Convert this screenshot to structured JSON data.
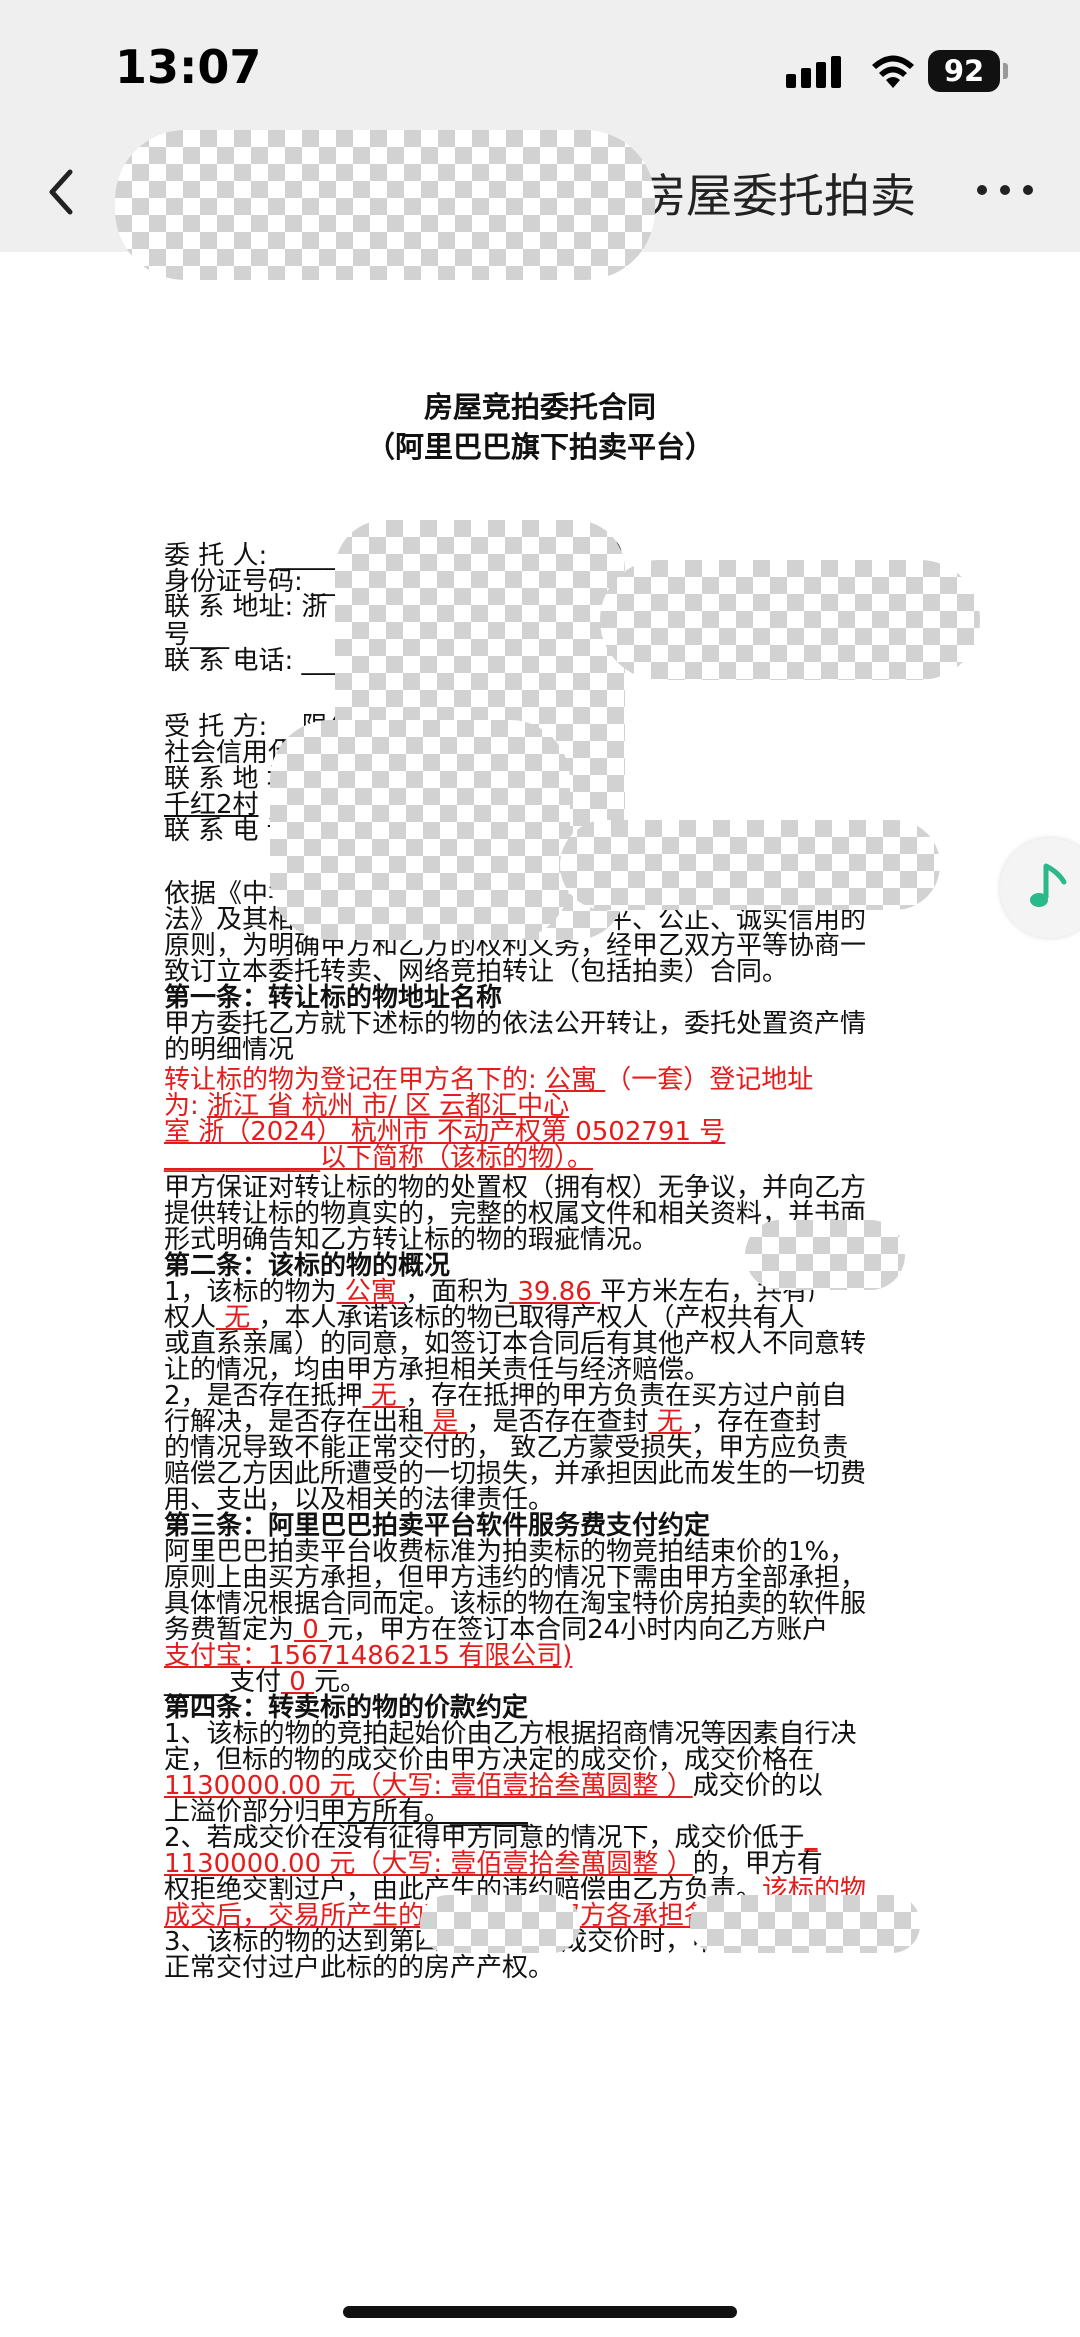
{
  "status": {
    "time": "13:07",
    "battery": "92"
  },
  "nav": {
    "title": "房屋委托拍卖"
  },
  "doc": {
    "title": "房屋竞拍委托合同",
    "subtitle": "（阿里巴巴旗下拍卖平台）",
    "lines": [
      {
        "segs": [
          {
            "t": "委 托 人: ___"
          },
          {
            "t": "_________以下简称（甲方）"
          }
        ]
      },
      {
        "segs": [
          {
            "t": "身份证号码: "
          },
          {
            "t": "____"
          }
        ]
      },
      {
        "segs": [
          {
            "t": "联 系 地址: 浙"
          }
        ]
      },
      {
        "segs": [
          {
            "t": "号___"
          }
        ]
      },
      {
        "segs": [
          {
            "t": "联 系 电话: ___"
          },
          {
            "t": "___________"
          }
        ]
      },
      {
        "segs": [
          {
            "t": "受 托 方: __"
          },
          {
            "t": "限公司 以下简称（乙方）"
          }
        ]
      },
      {
        "segs": [
          {
            "t": "社会信用代码:"
          },
          {
            "t": "___"
          }
        ]
      },
      {
        "segs": [
          {
            "t": "联 系 地 址: "
          }
        ]
      },
      {
        "segs": [
          {
            "t": "千红2村",
            "c": "u"
          }
        ]
      },
      {
        "segs": [
          {
            "t": "联 系 电 话: 15071"
          },
          {
            "t": "__________"
          }
        ]
      },
      {
        "segs": [
          {
            "t": "    依据《中华人民共和国民法典》、《中华人民共和国拍卖"
          }
        ]
      },
      {
        "segs": [
          {
            "t": "法》及其相关法律法规，秉持公开、公平、公正、诚实信用的"
          }
        ]
      },
      {
        "segs": [
          {
            "t": "原则，为明确甲方和乙方的权利义务，经甲乙双方平等协商一"
          }
        ]
      },
      {
        "segs": [
          {
            "t": "致订立本委托转卖、网络竞拍转让（包括拍卖）合同。"
          }
        ]
      },
      {
        "segs": [
          {
            "t": "第一条：转让标的物地址名称",
            "c": "b"
          }
        ]
      },
      {
        "segs": [
          {
            "t": "甲方委托乙方就下述标的物的依法公开转让，委托处置资产情"
          }
        ]
      },
      {
        "segs": [
          {
            "t": "的明细情况"
          }
        ]
      },
      {
        "segs": [
          {
            "t": "转让标的物为登记在甲方名下的: ",
            "c": "red"
          },
          {
            "t": " 公寓 ",
            "c": "red u"
          },
          {
            "t": "（一套）登记地址",
            "c": "red"
          }
        ]
      },
      {
        "segs": [
          {
            "t": "      为: ",
            "c": "red"
          },
          {
            "t": " 浙江  省   杭州  市/   区 云都汇中心",
            "c": "red u"
          }
        ]
      },
      {
        "segs": [
          {
            "t": "      ",
            "c": "red"
          },
          {
            "t": "室 浙（2024）   杭州市 不动产权第 0502791 号",
            "c": "red u"
          }
        ]
      },
      {
        "segs": [
          {
            "t": "      ",
            "c": "red"
          },
          {
            "t": "____________以下简称（该标的物）。",
            "c": "red u"
          }
        ]
      },
      {
        "segs": [
          {
            "t": "甲方保证对转让标的物的处置权（拥有权）无争议，并向乙方"
          }
        ]
      },
      {
        "segs": [
          {
            "t": "提供转让标的物真实的，完整的权属文件和相关资料，并书面"
          }
        ]
      },
      {
        "segs": [
          {
            "t": "形式明确告知乙方转让标的物的瑕疵情况。"
          }
        ]
      },
      {
        "segs": [
          {
            "t": "第二条：该标的物的概况",
            "c": "b"
          }
        ]
      },
      {
        "segs": [
          {
            "t": "1，该标的物为"
          },
          {
            "t": " 公寓   ",
            "c": "red u"
          },
          {
            "t": "，面积为"
          },
          {
            "t": "  39.86 ",
            "c": "red u"
          },
          {
            "t": "平方米左右，共有产"
          }
        ]
      },
      {
        "segs": [
          {
            "t": "权人"
          },
          {
            "t": "   无     ",
            "c": "red u"
          },
          {
            "t": "，本人承诺该标的物已取得产权人（产权共有人"
          }
        ]
      },
      {
        "segs": [
          {
            "t": "或直系亲属）的同意，如签订本合同后有其他产权人不同意转"
          }
        ]
      },
      {
        "segs": [
          {
            "t": "让的情况，均由甲方承担相关责任与经济赔偿。"
          }
        ]
      },
      {
        "segs": [
          {
            "t": "2，是否存在抵押"
          },
          {
            "t": " 无   ",
            "c": "red u"
          },
          {
            "t": "，存在抵押的甲方负责在买方过户前自"
          }
        ]
      },
      {
        "segs": [
          {
            "t": "行解决，是否存在出租"
          },
          {
            "t": " 是  ",
            "c": "red u"
          },
          {
            "t": "，是否存在查封"
          },
          {
            "t": "  无  ",
            "c": "red u"
          },
          {
            "t": "，存在查封"
          }
        ]
      },
      {
        "segs": [
          {
            "t": "的情况导致不能正常交付的， 致乙方蒙受损失，甲方应负责"
          }
        ]
      },
      {
        "segs": [
          {
            "t": "赔偿乙方因此所遭受的一切损失，并承担因此而发生的一切费"
          }
        ]
      },
      {
        "segs": [
          {
            "t": "用、支出，以及相关的法律责任。"
          }
        ]
      },
      {
        "segs": [
          {
            "t": "第三条：阿里巴巴拍卖平台软件服务费支付约定",
            "c": "b"
          }
        ]
      },
      {
        "segs": [
          {
            "t": "阿里巴巴拍卖平台收费标准为拍卖标的物竞拍结束价的1%，"
          }
        ]
      },
      {
        "segs": [
          {
            "t": "原则上由买方承担，但甲方违约的情况下需由甲方全部承担，"
          }
        ]
      },
      {
        "segs": [
          {
            "t": "具体情况根据合同而定。该标的物在淘宝特价房拍卖的软件服"
          }
        ]
      },
      {
        "segs": [
          {
            "t": "务费暂定为"
          },
          {
            "t": "  0  ",
            "c": "red u"
          },
          {
            "t": "元，甲方在签订本合同24小时内向乙方账户"
          }
        ]
      },
      {
        "segs": [
          {
            "t": "支付宝：15671486215",
            "c": "red u"
          },
          {
            "t": "                              有限公司)",
            "c": "red u"
          }
        ]
      },
      {
        "segs": [
          {
            "t": "_____支付"
          },
          {
            "t": "    0   ",
            "c": "red u"
          },
          {
            "t": "元。"
          }
        ]
      },
      {
        "segs": [
          {
            "t": "第四条：转卖标的物的价款约定",
            "c": "b"
          }
        ]
      },
      {
        "segs": [
          {
            "t": "1、该标的物的竞拍起始价由乙方根据招商情况等因素自行决"
          }
        ]
      },
      {
        "segs": [
          {
            "t": "定，但标的物的成交价由甲方决定的成交价，成交价格在"
          }
        ]
      },
      {
        "segs": [
          {
            "t": "1130000.00   元（大写:  壹佰壹拾叁萬圆整      ）",
            "c": "red u"
          },
          {
            "t": "成交价的以"
          }
        ]
      },
      {
        "segs": [
          {
            "t": "上溢价部分归"
          },
          {
            "t": "甲方所有。______",
            "c": "u"
          }
        ]
      },
      {
        "segs": [
          {
            "t": "2、若成交价在没有征得甲方同意的情况下，成交价低于"
          },
          {
            "t": "_",
            "c": "red u"
          }
        ]
      },
      {
        "segs": [
          {
            "t": "1130000.00    元（大写:  壹佰壹拾叁萬圆整   ）",
            "c": "red u"
          },
          {
            "t": "的，甲方有"
          }
        ]
      },
      {
        "segs": [
          {
            "t": "权拒绝交割过户，由此产生的违约赔偿由乙方负责。"
          },
          {
            "t": "该标的物",
            "c": "red"
          }
        ]
      },
      {
        "segs": [
          {
            "t": "成交后，交易所产生的税费由买卖双方各承担各的税 。",
            "c": "red u"
          }
        ]
      },
      {
        "segs": [
          {
            "t": "3、该标的物的达到第四条第1条的成交价时，甲方必须按合同"
          }
        ]
      },
      {
        "segs": [
          {
            "t": "正常交付过户此标的的房产产权。"
          }
        ]
      }
    ]
  }
}
